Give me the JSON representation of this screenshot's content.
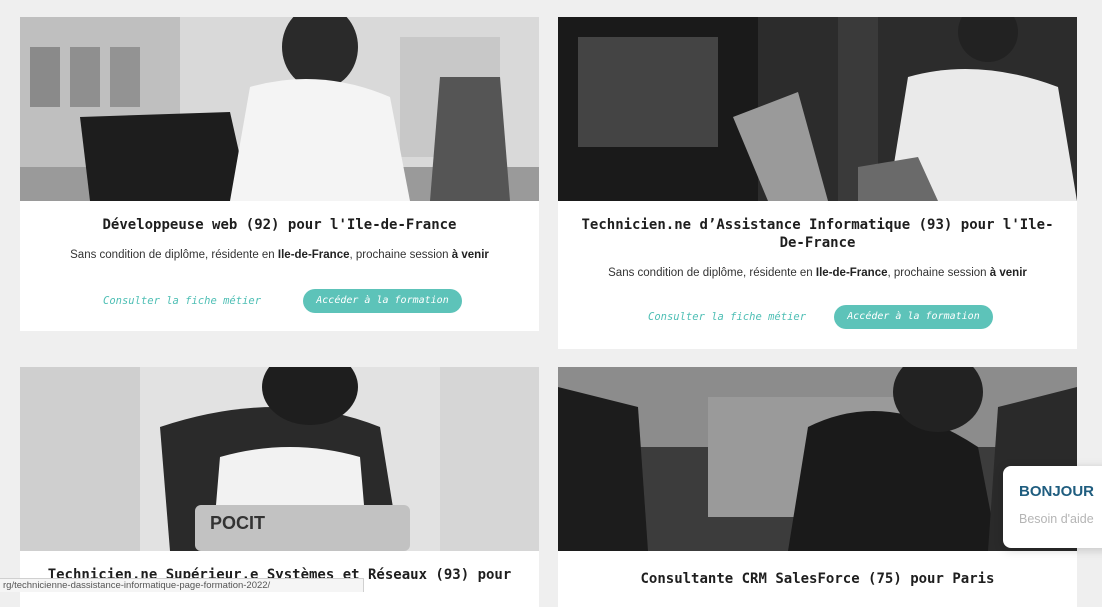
{
  "cards": [
    {
      "title": "Développeuse web (92) pour l'Ile-de-France",
      "sub_prefix": "Sans condition de diplôme, résidente en ",
      "sub_region": "Ile-de-France",
      "sub_mid": ", prochaine session ",
      "sub_session": "à venir",
      "link_label": "Consulter la fiche métier",
      "button_label": "Accéder à la formation"
    },
    {
      "title": "Technicien.ne d’Assistance Informatique (93) pour l'Ile-De-France",
      "sub_prefix": "Sans condition de diplôme, résidente en ",
      "sub_region": "Ile-de-France",
      "sub_mid": ", prochaine session ",
      "sub_session": "à venir",
      "link_label": "Consulter la fiche métier",
      "button_label": "Accéder à la formation"
    },
    {
      "title": "Technicien.ne Supérieur.e Systèmes et Réseaux (93) pour"
    },
    {
      "title": "Consultante CRM SalesForce (75) pour Paris"
    }
  ],
  "chat_widget": {
    "title": "BONJOUR",
    "subtitle": "Besoin d'aide"
  },
  "status_url": "rg/technicienne-dassistance-informatique-page-formation-2022/",
  "image_labels": {
    "laptop_sticker": "POCIT"
  },
  "colors": {
    "accent": "#5dc3b9",
    "chat_title": "#1f5d7f",
    "background": "#efefef"
  }
}
